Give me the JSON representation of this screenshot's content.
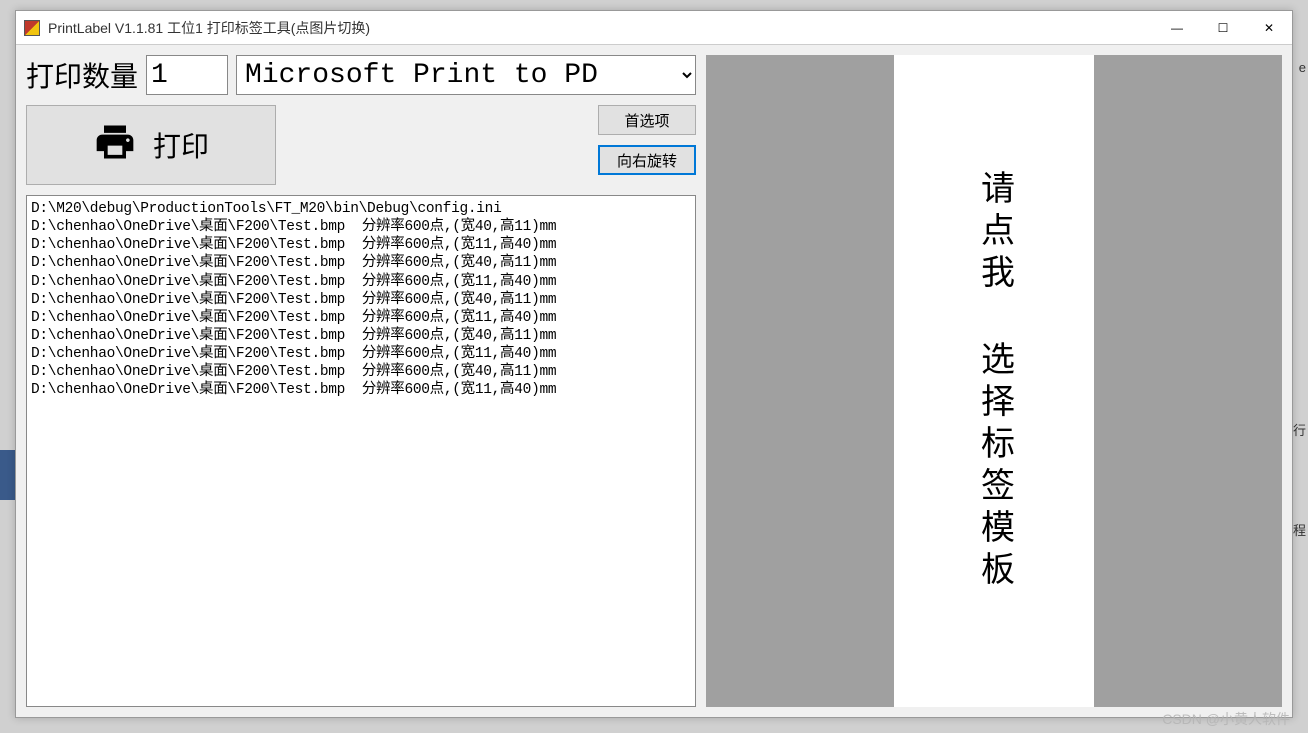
{
  "window": {
    "title": "PrintLabel V1.1.81 工位1 打印标签工具(点图片切换)"
  },
  "controls": {
    "qty_label": "打印数量",
    "qty_value": "1",
    "printer_selected": "Microsoft Print to PD",
    "print_button": "打印",
    "preferences_button": "首选项",
    "rotate_button": "向右旋转"
  },
  "log_lines": [
    "D:\\M20\\debug\\ProductionTools\\FT_M20\\bin\\Debug\\config.ini",
    "D:\\chenhao\\OneDrive\\桌面\\F200\\Test.bmp  分辨率600点,(宽40,高11)mm",
    "D:\\chenhao\\OneDrive\\桌面\\F200\\Test.bmp  分辨率600点,(宽11,高40)mm",
    "D:\\chenhao\\OneDrive\\桌面\\F200\\Test.bmp  分辨率600点,(宽40,高11)mm",
    "D:\\chenhao\\OneDrive\\桌面\\F200\\Test.bmp  分辨率600点,(宽11,高40)mm",
    "D:\\chenhao\\OneDrive\\桌面\\F200\\Test.bmp  分辨率600点,(宽40,高11)mm",
    "D:\\chenhao\\OneDrive\\桌面\\F200\\Test.bmp  分辨率600点,(宽11,高40)mm",
    "D:\\chenhao\\OneDrive\\桌面\\F200\\Test.bmp  分辨率600点,(宽40,高11)mm",
    "D:\\chenhao\\OneDrive\\桌面\\F200\\Test.bmp  分辨率600点,(宽11,高40)mm",
    "D:\\chenhao\\OneDrive\\桌面\\F200\\Test.bmp  分辨率600点,(宽40,高11)mm",
    "D:\\chenhao\\OneDrive\\桌面\\F200\\Test.bmp  分辨率600点,(宽11,高40)mm"
  ],
  "preview": {
    "placeholder_text": "请点我 选择标签模板"
  },
  "titlebar_icons": {
    "minimize": "—",
    "maximize": "☐",
    "close": "✕"
  },
  "watermark": "CSDN @小黄人软件",
  "bg_hints": {
    "r1": "e",
    "r2": "行",
    "r3": "程"
  }
}
